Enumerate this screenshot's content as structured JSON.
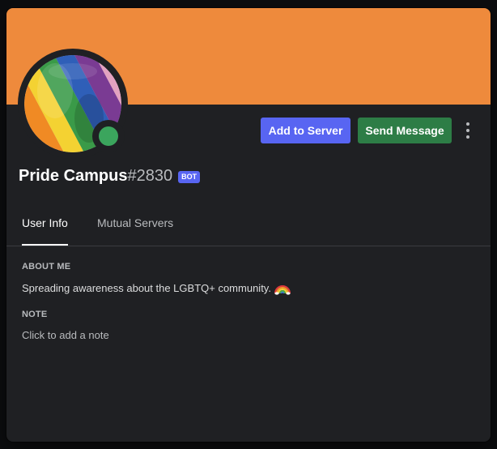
{
  "colors": {
    "banner": "#ee8a3c",
    "modal_bg": "#1f2023",
    "add_button": "#5865f2",
    "send_button": "#2d7d46",
    "bot_tag": "#5865f2",
    "status_online": "#3ba55d"
  },
  "profile": {
    "username": "Pride Campus",
    "discriminator": "#2830",
    "bot_tag": "BOT",
    "status": "online",
    "avatar": "rainbow-pride-flag"
  },
  "actions": {
    "add_to_server": "Add to Server",
    "send_message": "Send Message",
    "more_icon": "kebab-menu-icon"
  },
  "tabs": [
    {
      "label": "User Info",
      "active": true
    },
    {
      "label": "Mutual Servers",
      "active": false
    }
  ],
  "about": {
    "title": "ABOUT ME",
    "text": "Spreading awareness about the LGBTQ+ community.",
    "emoji": "rainbow-icon"
  },
  "note": {
    "title": "NOTE",
    "placeholder": "Click to add a note"
  }
}
